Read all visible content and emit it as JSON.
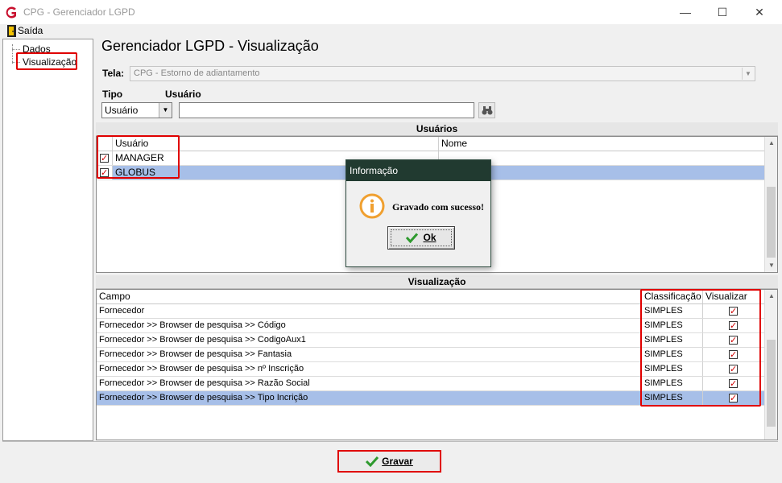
{
  "window": {
    "title": "CPG - Gerenciador LGPD",
    "minimize_glyph": "—",
    "maximize_glyph": "☐",
    "close_glyph": "✕",
    "icon": "app-logo-icon"
  },
  "menu": {
    "exit_label": "Saída",
    "exit_icon": "door-exit-icon"
  },
  "tree": {
    "items": [
      {
        "label": "Dados"
      },
      {
        "label": "Visualização",
        "highlighted": true
      }
    ]
  },
  "page": {
    "heading": "Gerenciador LGPD - Visualização"
  },
  "filters": {
    "tela_label": "Tela:",
    "tela_value": "CPG - Estorno de adiantamento",
    "tipo_label": "Tipo",
    "tipo_value": "Usuário",
    "usuario_label": "Usuário",
    "usuario_value": "",
    "search_icon": "binoculars-icon"
  },
  "users_section": {
    "title": "Usuários",
    "columns": [
      "Usuário",
      "Nome"
    ],
    "rows": [
      {
        "checked": true,
        "user": "MANAGER",
        "name": "",
        "selected": false
      },
      {
        "checked": true,
        "user": "GLOBUS",
        "name": "",
        "selected": true
      }
    ]
  },
  "visual_section": {
    "title": "Visualização",
    "columns": [
      "Campo",
      "Classificação",
      "Visualizar"
    ],
    "rows": [
      {
        "campo": "Fornecedor",
        "classificacao": "SIMPLES",
        "visualizar": true,
        "selected": false
      },
      {
        "campo": "Fornecedor >> Browser de pesquisa >> Código",
        "classificacao": "SIMPLES",
        "visualizar": true,
        "selected": false
      },
      {
        "campo": "Fornecedor >> Browser de pesquisa >> CodigoAux1",
        "classificacao": "SIMPLES",
        "visualizar": true,
        "selected": false
      },
      {
        "campo": "Fornecedor >> Browser de pesquisa >> Fantasia",
        "classificacao": "SIMPLES",
        "visualizar": true,
        "selected": false
      },
      {
        "campo": "Fornecedor >> Browser de pesquisa >> nº Inscrição",
        "classificacao": "SIMPLES",
        "visualizar": true,
        "selected": false
      },
      {
        "campo": "Fornecedor >> Browser de pesquisa >> Razão Social",
        "classificacao": "SIMPLES",
        "visualizar": true,
        "selected": false
      },
      {
        "campo": "Fornecedor >> Browser de pesquisa >> Tipo Incrição",
        "classificacao": "SIMPLES",
        "visualizar": true,
        "selected": true
      }
    ]
  },
  "dialog": {
    "title": "Informação",
    "message": "Gravado com sucesso!",
    "icon": "info-circle-icon",
    "ok_label": "Ok"
  },
  "footer": {
    "save_label": "Gravar",
    "save_icon": "checkmark-icon"
  },
  "colors": {
    "accent_red": "#e00000",
    "selection": "#a7bfe8",
    "dialog_title_bg": "#213a30",
    "check_green": "#2e9a2e",
    "info_orange": "#f0a030"
  }
}
